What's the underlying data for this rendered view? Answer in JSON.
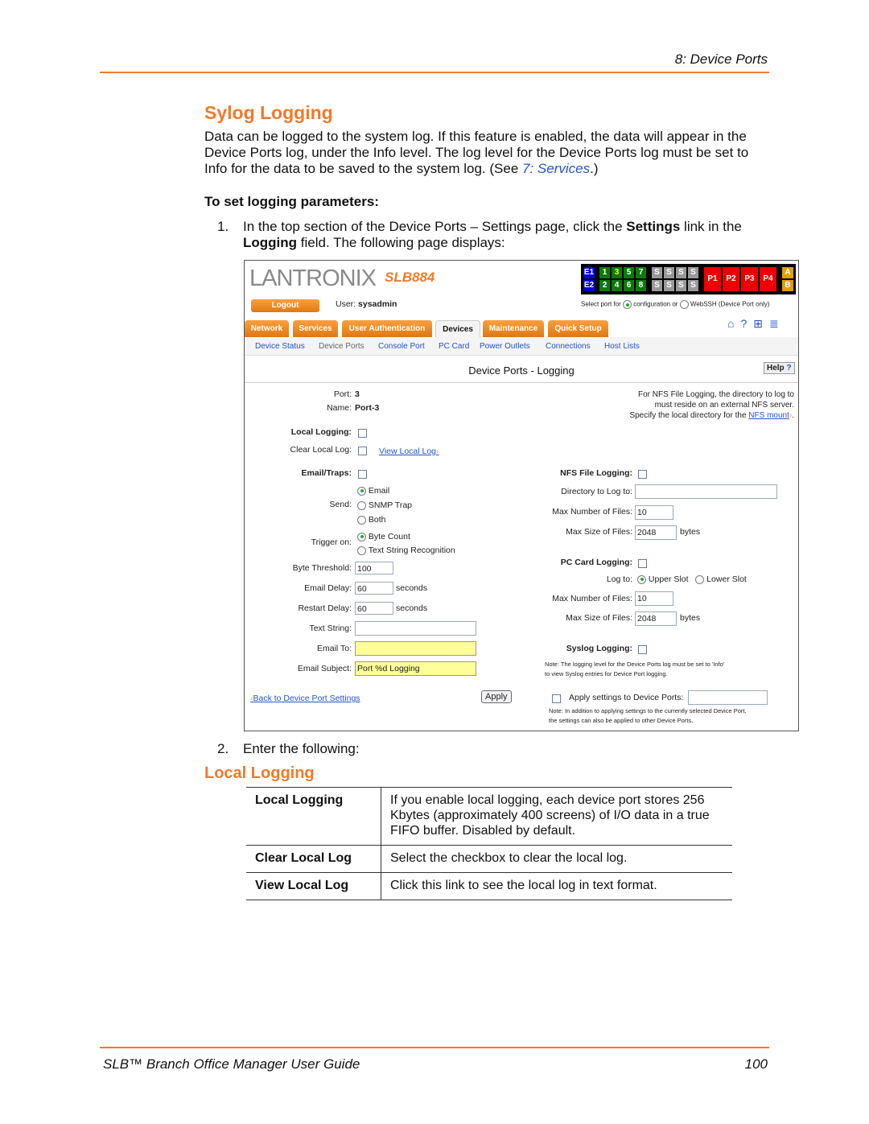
{
  "header": {
    "chapter": "8: Device Ports"
  },
  "section": {
    "title": "Sylog Logging",
    "para_before": "Data can be logged to the system log. If this feature is enabled, the data will appear in the Device Ports log, under the Info level. The log level for the Device Ports log must be set to Info for the data to be saved to the system log. (See ",
    "para_link": "7: Services",
    "para_after": ".)"
  },
  "procedure": {
    "title": "To set logging parameters:",
    "step1_num": "1.",
    "step1_a": "In the top section of the Device Ports – Settings page, click the ",
    "step1_b": "Settings",
    "step1_c": " link in the ",
    "step1_d": "Logging",
    "step1_e": " field. The following page displays:",
    "step2_num": "2.",
    "step2": "Enter the following:"
  },
  "screenshot": {
    "logo": "LANTRONIX",
    "model": "SLB884",
    "logout": "Logout",
    "user_label": "User:",
    "user": "sysadmin",
    "ports": {
      "e": [
        "E1",
        "E2"
      ],
      "top": [
        "1",
        "3",
        "5",
        "7"
      ],
      "bottom": [
        "2",
        "4",
        "6",
        "8"
      ],
      "s": "S",
      "p": [
        "P1",
        "P2",
        "P3",
        "P4"
      ],
      "ab": [
        "A",
        "B"
      ]
    },
    "select_port_for": "Select port for",
    "configuration": "configuration or",
    "webssh": "WebSSH (Device Port only)",
    "tabs": [
      "Network",
      "Services",
      "User Authentication",
      "Devices",
      "Maintenance",
      "Quick Setup"
    ],
    "subnav": [
      "Device Status",
      "Device Ports",
      "Console Port",
      "PC Card",
      "Power Outlets",
      "Connections",
      "Host Lists"
    ],
    "page_title": "Device Ports - Logging",
    "help": "Help",
    "port_label": "Port:",
    "port": "3",
    "name_label": "Name:",
    "name": "Port-3",
    "nfs_note1": "For NFS File Logging, the directory to log to",
    "nfs_note2": "must reside on an external NFS server.",
    "nfs_note3": "Specify the local directory for the ",
    "nfs_mount": "NFS mount",
    "local_logging": "Local Logging:",
    "clear_local_log": "Clear Local Log:",
    "view_local_log": "View Local Log",
    "email_traps": "Email/Traps:",
    "send": "Send:",
    "send_options": [
      "Email",
      "SNMP Trap",
      "Both"
    ],
    "trigger_on": "Trigger on:",
    "trigger_options": [
      "Byte Count",
      "Text String Recognition"
    ],
    "byte_threshold": "Byte Threshold:",
    "byte_threshold_value": "100",
    "email_delay": "Email Delay:",
    "email_delay_value": "60",
    "seconds": "seconds",
    "restart_delay": "Restart Delay:",
    "restart_delay_value": "60",
    "text_string": "Text String:",
    "email_to": "Email To:",
    "email_subject": "Email Subject:",
    "email_subject_value": "Port %d Logging",
    "back": "Back to Device Port Settings",
    "apply": "Apply",
    "nfs_file_logging": "NFS File Logging:",
    "directory": "Directory to Log to:",
    "max_files": "Max Number of Files:",
    "max_files_value": "10",
    "max_size": "Max Size of Files:",
    "max_size_value": "2048",
    "bytes": "bytes",
    "pc_card_logging": "PC Card Logging:",
    "log_to": "Log to:",
    "upper_slot": "Upper Slot",
    "lower_slot": "Lower Slot",
    "syslog_logging": "Syslog Logging:",
    "syslog_note1": "Note: The logging level for the Device Ports log must be set to 'Info'",
    "syslog_note2": "to view Syslog entries for Device Port logging.",
    "apply_settings": "Apply settings to Device Ports:",
    "apply_note1": "Note: In addition to applying settings to the currently selected Device Port,",
    "apply_note2": "the settings can also be applied to other Device Ports."
  },
  "local_logging": {
    "title": "Local Logging",
    "rows": [
      {
        "term": "Local Logging",
        "desc": "If you enable local logging, each device port stores 256 Kbytes (approximately 400 screens) of I/O data in a true FIFO buffer. Disabled by default."
      },
      {
        "term": "Clear Local Log",
        "desc": "Select the checkbox to clear the local log."
      },
      {
        "term": "View Local Log",
        "desc": "Click this link to see the local log in text format."
      }
    ]
  },
  "footer": {
    "title": "SLB™ Branch Office Manager User Guide",
    "page": "100"
  },
  "colors": {
    "accent": "#f07a2a",
    "link": "#2255cc"
  }
}
